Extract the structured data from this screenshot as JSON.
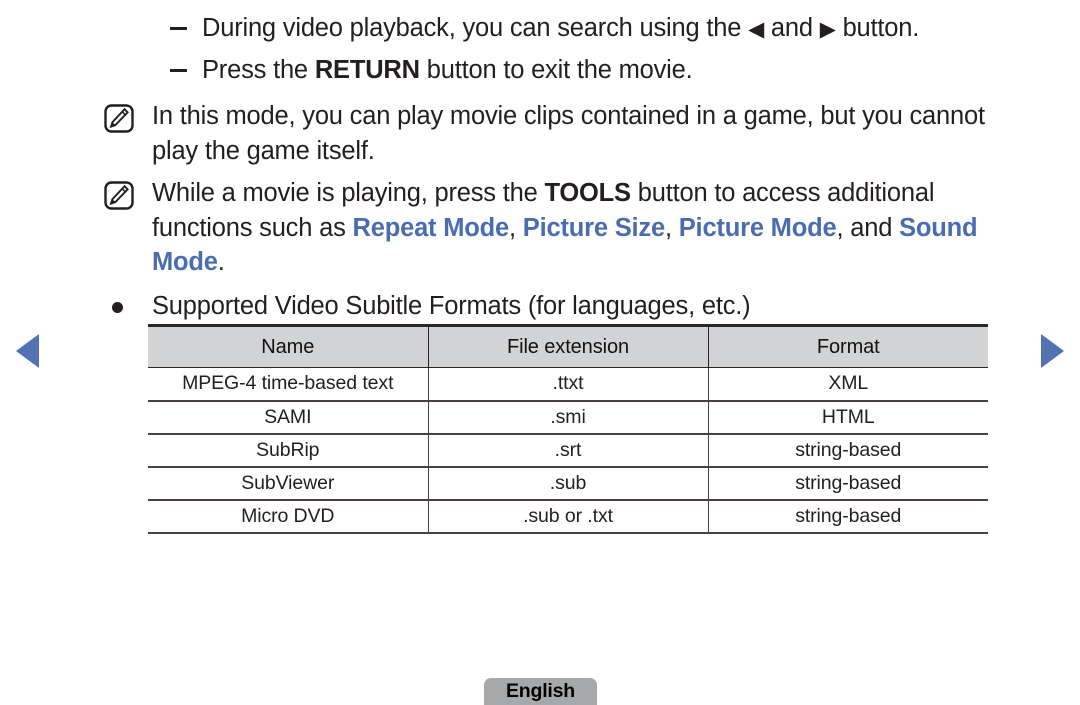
{
  "nav": {
    "prev_label": "previous page",
    "next_label": "next page",
    "arrow_color": "#5272b4"
  },
  "dash_items": [
    {
      "text_before": "During video playback, you can search using the ",
      "glyph_left": "◀",
      "text_middle": " and ",
      "glyph_right": "▶",
      "text_after": " button."
    }
  ],
  "dash_item_2": {
    "text_before": "Press the ",
    "bold": "RETURN",
    "text_after": " button to exit the movie."
  },
  "notes": [
    {
      "icon": "note-pencil-icon",
      "text": "In this mode, you can play movie clips contained in a game, but you cannot play the game itself."
    }
  ],
  "note_tools": {
    "icon": "note-pencil-icon",
    "seg1": "While a movie is playing, press the ",
    "bold_tools": "TOOLS",
    "seg2": " button to access additional functions such as ",
    "link1": "Repeat Mode",
    "sep1": ", ",
    "link2": "Picture Size",
    "sep2": ", ",
    "link3": "Picture Mode",
    "sep3": ", and ",
    "link4": "Sound Mode",
    "end": ".",
    "link_color": "#4a6cb0"
  },
  "bullet": {
    "text": "Supported Video Subitle Formats (for languages, etc.)"
  },
  "table": {
    "headers": [
      "Name",
      "File extension",
      "Format"
    ],
    "rows": [
      [
        "MPEG-4 time-based text",
        ".ttxt",
        "XML"
      ],
      [
        "SAMI",
        ".smi",
        "HTML"
      ],
      [
        "SubRip",
        ".srt",
        "string-based"
      ],
      [
        "SubViewer",
        ".sub",
        "string-based"
      ],
      [
        "Micro DVD",
        ".sub or .txt",
        "string-based"
      ]
    ],
    "header_bg": "#d2d3d5",
    "border_color": "#4a3f42"
  },
  "footer": {
    "language_label": "English",
    "button_bg": "#a6a8aa"
  }
}
